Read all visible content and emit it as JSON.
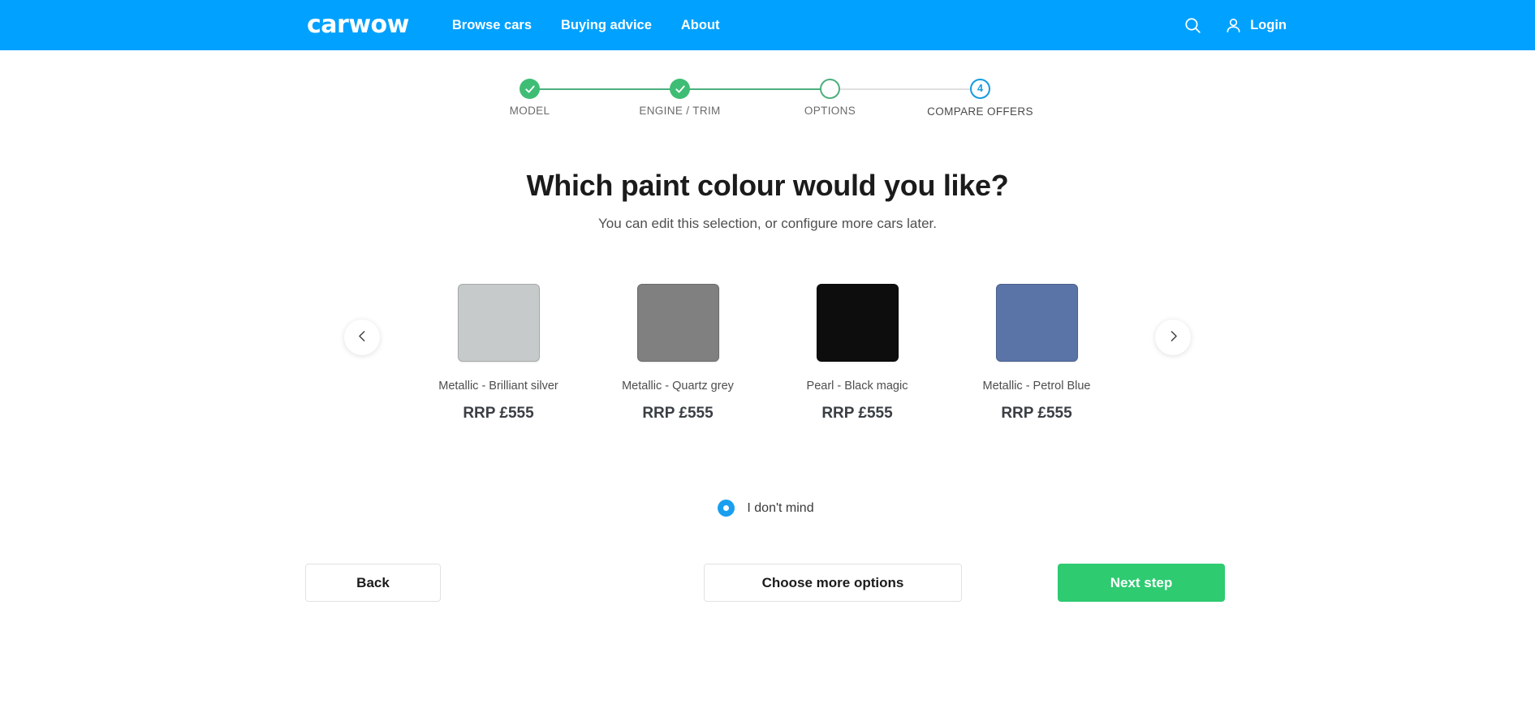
{
  "header": {
    "logo_text": "carwow",
    "nav": [
      {
        "label": "Browse cars"
      },
      {
        "label": "Buying advice"
      },
      {
        "label": "About"
      }
    ],
    "search_icon": "search-icon",
    "account_icon": "user-icon",
    "login_label": "Login",
    "background_color": "#00a1ff"
  },
  "stepper": {
    "steps": [
      {
        "label": "MODEL",
        "state": "complete",
        "marker": "check"
      },
      {
        "label": "ENGINE / TRIM",
        "state": "complete",
        "marker": "check"
      },
      {
        "label": "OPTIONS",
        "state": "current",
        "marker": ""
      },
      {
        "label": "COMPARE OFFERS",
        "state": "upcoming",
        "marker": "4"
      }
    ],
    "complete_color": "#3fbd75",
    "current_color": "#4caf7d",
    "upcoming_color": "#159ce0",
    "track_pending_color": "#e0e0e0"
  },
  "main": {
    "title": "Which paint colour would you like?",
    "subtitle": "You can edit this selection, or configure more cars later.",
    "prev_arrow_icon": "chevron-left-icon",
    "next_arrow_icon": "chevron-right-icon",
    "swatches": [
      {
        "name": "Metallic - Brilliant silver",
        "price": "RRP £555",
        "color": "#c7cacb"
      },
      {
        "name": "Metallic - Quartz grey",
        "price": "RRP £555",
        "color": "#808080"
      },
      {
        "name": "Pearl - Black magic",
        "price": "RRP £555",
        "color": "#0d0d0d"
      },
      {
        "name": "Metallic - Petrol Blue",
        "price": "RRP £555",
        "color": "#5a74a8"
      }
    ],
    "no_preference": {
      "label": "I don't mind",
      "selected": true,
      "color": "#1a9ff0"
    }
  },
  "actions": {
    "back_label": "Back",
    "more_options_label": "Choose more options",
    "next_label": "Next step",
    "next_color": "#2ecb71"
  }
}
